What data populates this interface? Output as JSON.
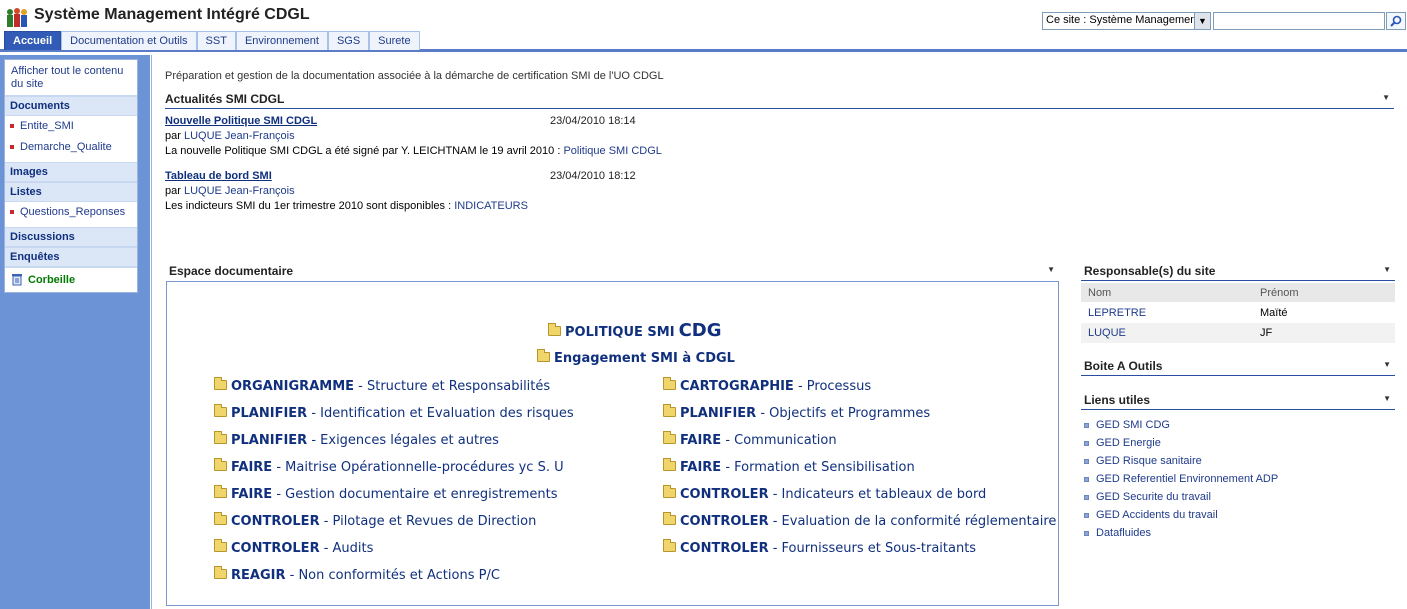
{
  "header": {
    "title": "Système Management Intégré CDGL",
    "scope_select": "Ce site : Système Management"
  },
  "tabs": [
    {
      "label": "Accueil",
      "active": true
    },
    {
      "label": "Documentation et Outils",
      "active": false
    },
    {
      "label": "SST",
      "active": false
    },
    {
      "label": "Environnement",
      "active": false
    },
    {
      "label": "SGS",
      "active": false
    },
    {
      "label": "Surete",
      "active": false
    }
  ],
  "leftnav": {
    "view_all": "Afficher tout le contenu du site",
    "sections": [
      {
        "title": "Documents",
        "items": [
          "Entite_SMI",
          "Demarche_Qualite"
        ]
      },
      {
        "title": "Images",
        "items": []
      },
      {
        "title": "Listes",
        "items": [
          "Questions_Reponses"
        ]
      },
      {
        "title": "Discussions",
        "items": []
      },
      {
        "title": "Enquêtes",
        "items": []
      }
    ],
    "recycle_bin": "Corbeille"
  },
  "main": {
    "description": "Préparation et gestion de la documentation associée à la démarche de certification SMI de l'UO CDGL",
    "news": {
      "title": "Actualités SMI CDGL",
      "items": [
        {
          "title": "Nouvelle Politique SMI CDGL",
          "date": "23/04/2010 18:14",
          "by_prefix": "par",
          "author": "LUQUE Jean-François",
          "body": "La nouvelle Politique SMI CDGL a été signé par Y. LEICHTNAM le 19 avril 2010 :",
          "link": "Politique SMI CDGL"
        },
        {
          "title": "Tableau de bord SMI",
          "date": "23/04/2010 18:12",
          "by_prefix": "par",
          "author": "LUQUE Jean-François",
          "body": "Les indicteurs SMI du 1er trimestre 2010 sont disponibles :",
          "link": "INDICATEURS"
        }
      ]
    },
    "docspace": {
      "title": "Espace documentaire",
      "politique_a": "POLITIQUE SMI",
      "politique_b": "CDG",
      "engagement": "Engagement SMI à CDGL",
      "left": [
        {
          "bold": "ORGANIGRAMME",
          "rest": " - Structure et Responsabilités"
        },
        {
          "bold": "PLANIFIER",
          "rest": " - Identification et Evaluation des risques"
        },
        {
          "bold": "PLANIFIER",
          "rest": " - Exigences légales et autres"
        },
        {
          "bold": "FAIRE",
          "rest": " - Maitrise Opérationnelle-procédures yc S. U"
        },
        {
          "bold": "FAIRE",
          "rest": " - Gestion documentaire et enregistrements"
        },
        {
          "bold": "CONTROLER",
          "rest": " - Pilotage et Revues de Direction"
        },
        {
          "bold": "CONTROLER",
          "rest": " - Audits"
        },
        {
          "bold": "REAGIR",
          "rest": " - Non conformités et Actions P/C"
        }
      ],
      "right": [
        {
          "bold": "CARTOGRAPHIE",
          "rest": " - Processus"
        },
        {
          "bold": "PLANIFIER",
          "rest": " - Objectifs et Programmes"
        },
        {
          "bold": "FAIRE",
          "rest": " - Communication"
        },
        {
          "bold": "FAIRE",
          "rest": " - Formation et Sensibilisation"
        },
        {
          "bold": "CONTROLER",
          "rest": " - Indicateurs et tableaux de bord"
        },
        {
          "bold": "CONTROLER",
          "rest": " - Evaluation de la conformité réglementaire"
        },
        {
          "bold": "CONTROLER",
          "rest": " - Fournisseurs et Sous-traitants"
        }
      ]
    }
  },
  "right": {
    "responsables": {
      "title": "Responsable(s) du site",
      "headers": [
        "Nom",
        "Prénom"
      ],
      "rows": [
        [
          "LEPRETRE",
          "Maïté"
        ],
        [
          "LUQUE",
          "JF"
        ]
      ]
    },
    "toolbox_title": "Boite A Outils",
    "links": {
      "title": "Liens utiles",
      "items": [
        "GED SMI CDG",
        "GED Energie",
        "GED Risque sanitaire",
        "GED Referentiel Environnement ADP",
        "GED Securite du travail",
        "GED Accidents du travail",
        "Datafluides"
      ]
    }
  }
}
